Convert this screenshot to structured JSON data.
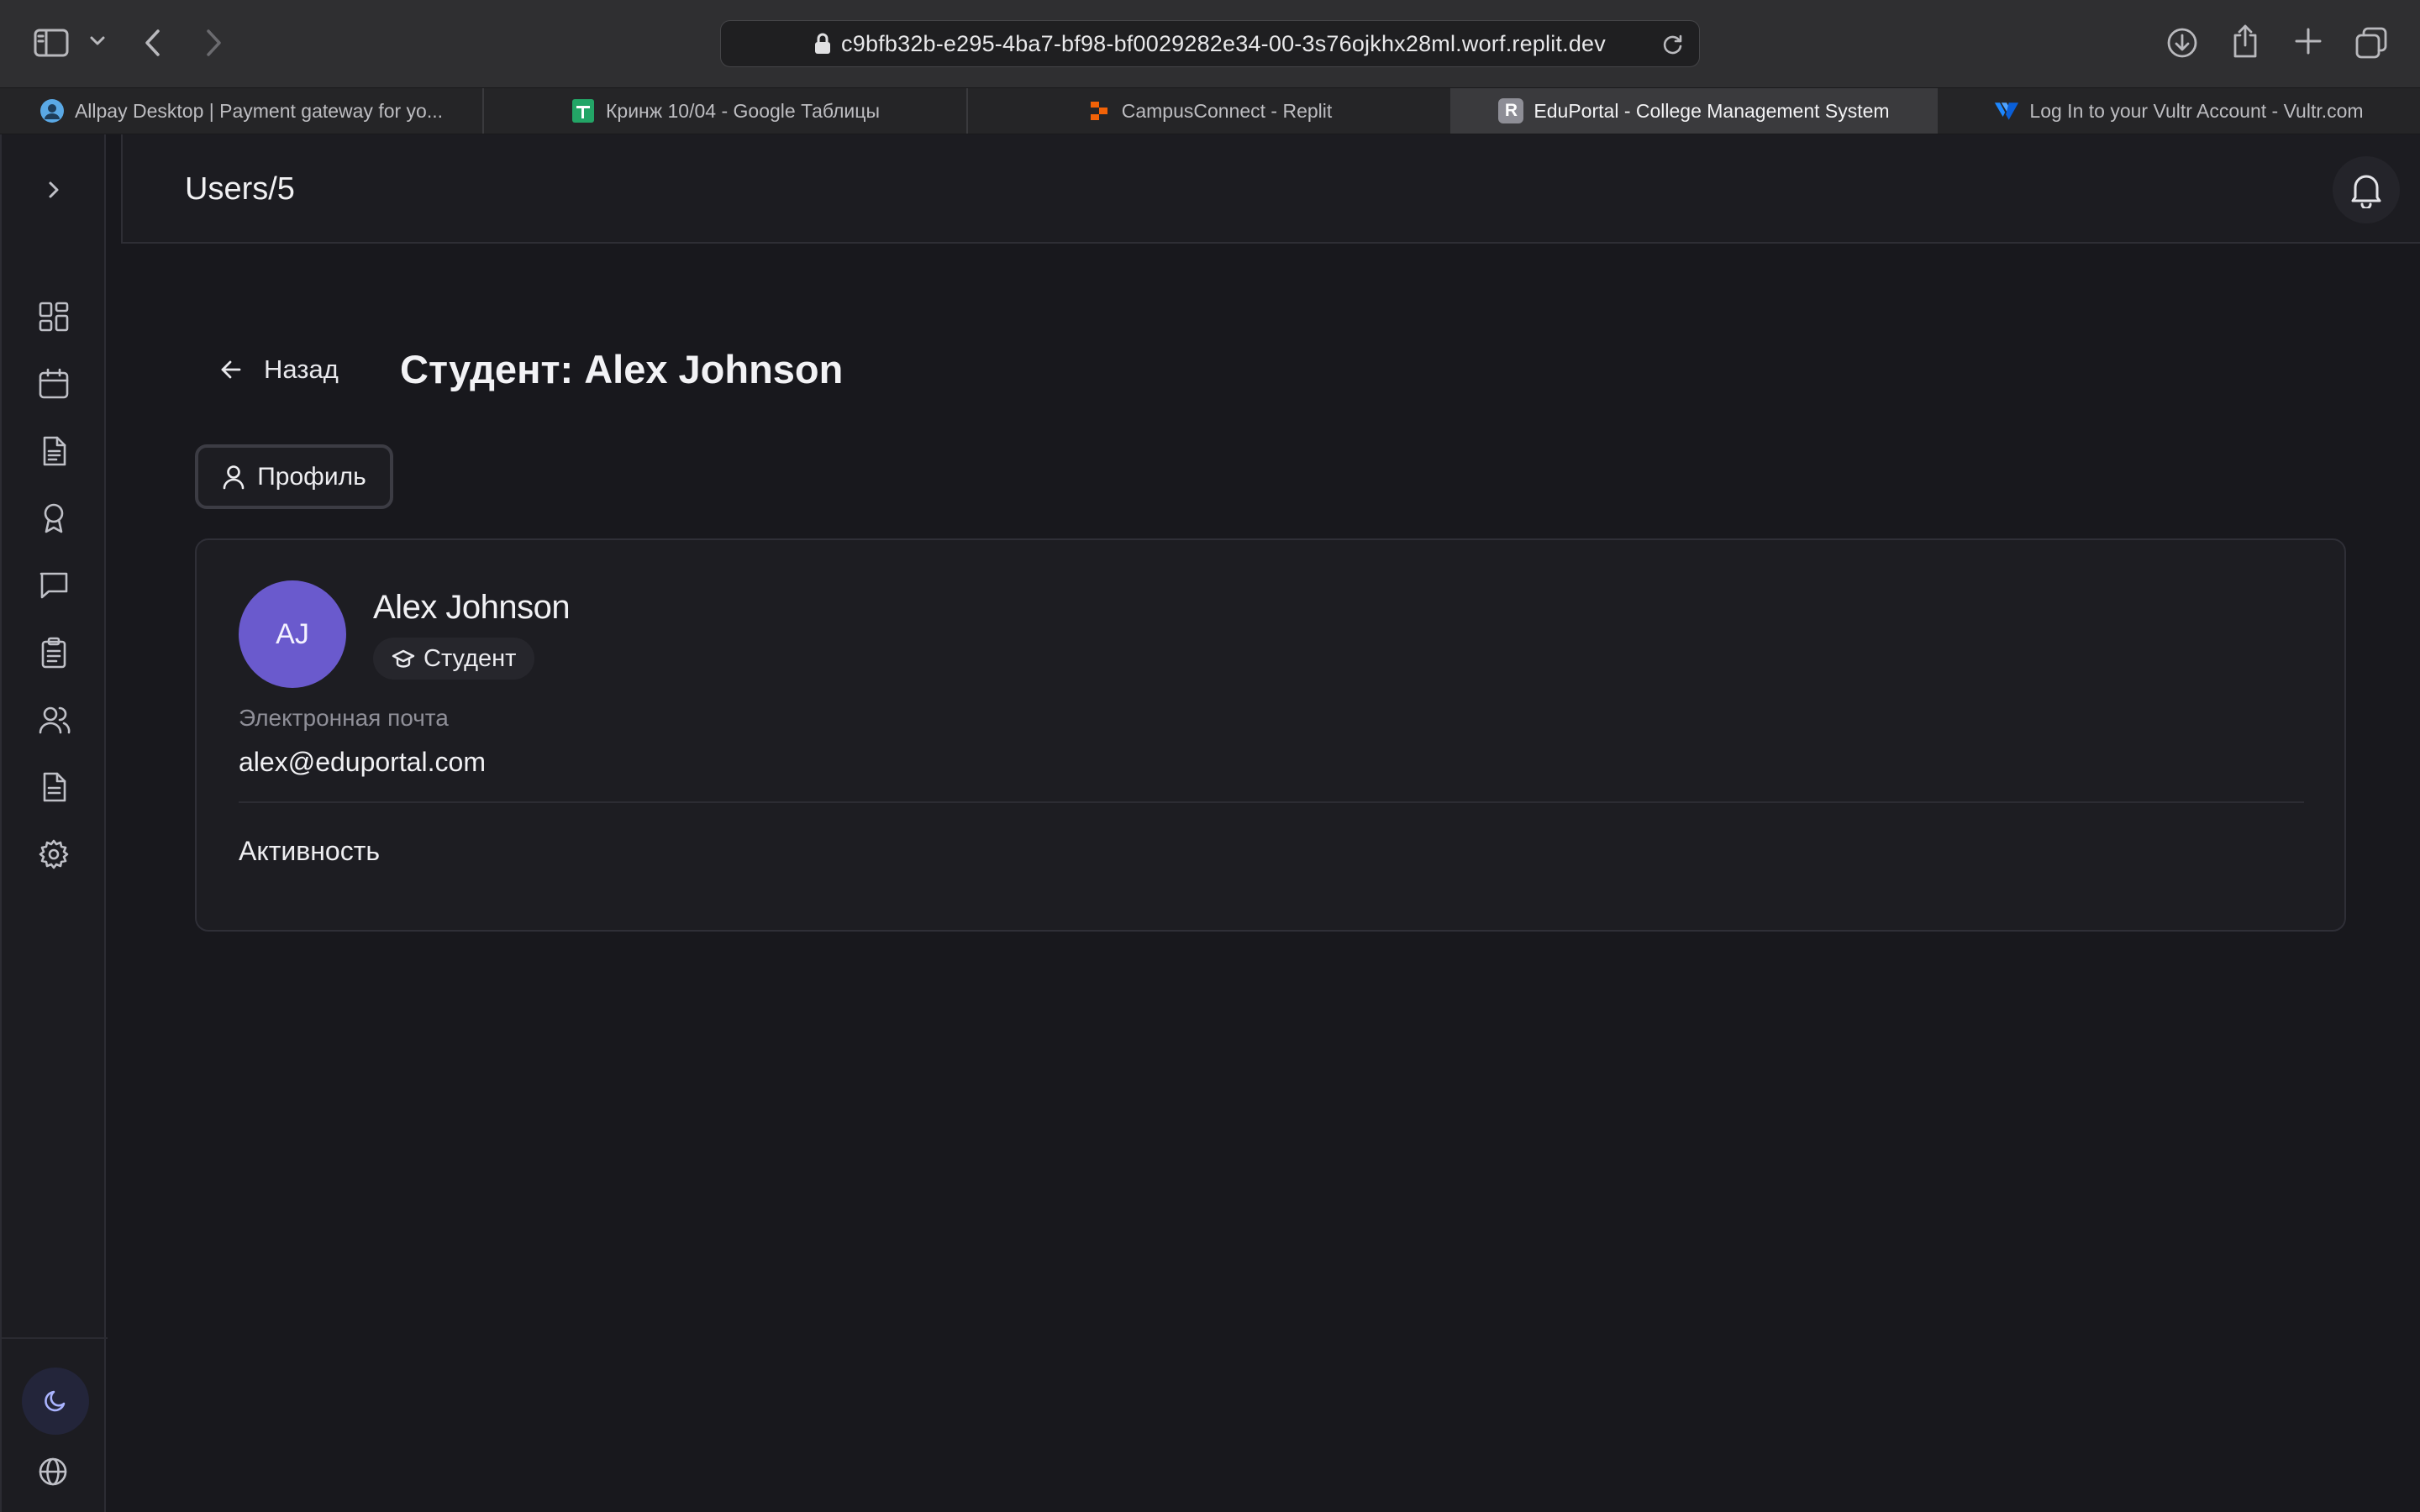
{
  "browser": {
    "url": "c9bfb32b-e295-4ba7-bf98-bf0029282e34-00-3s76ojkhx28ml.worf.replit.dev",
    "tabs": [
      {
        "title": "Allpay Desktop | Payment gateway for yo...",
        "icon": "user-circle-icon",
        "active": false
      },
      {
        "title": "Кринж 10/04 - Google Таблицы",
        "icon": "sheets-icon",
        "active": false
      },
      {
        "title": "CampusConnect - Replit",
        "icon": "replit-icon",
        "active": false
      },
      {
        "title": "EduPortal - College Management System",
        "icon": "r-letter-icon",
        "active": true
      },
      {
        "title": "Log In to your Vultr Account - Vultr.com",
        "icon": "vultr-icon",
        "active": false
      }
    ],
    "tab_letter": "R"
  },
  "header": {
    "path": "Users/5"
  },
  "page": {
    "back_label": "Назад",
    "title": "Студент: Alex Johnson",
    "profile_tab_label": "Профиль"
  },
  "user": {
    "initials": "AJ",
    "name": "Alex Johnson",
    "role": "Студент",
    "email_label": "Электронная почта",
    "email": "alex@eduportal.com",
    "activity_heading": "Активность"
  },
  "colors": {
    "accent_avatar": "#6a5acd",
    "background": "#18181d",
    "card": "#1d1d22"
  }
}
